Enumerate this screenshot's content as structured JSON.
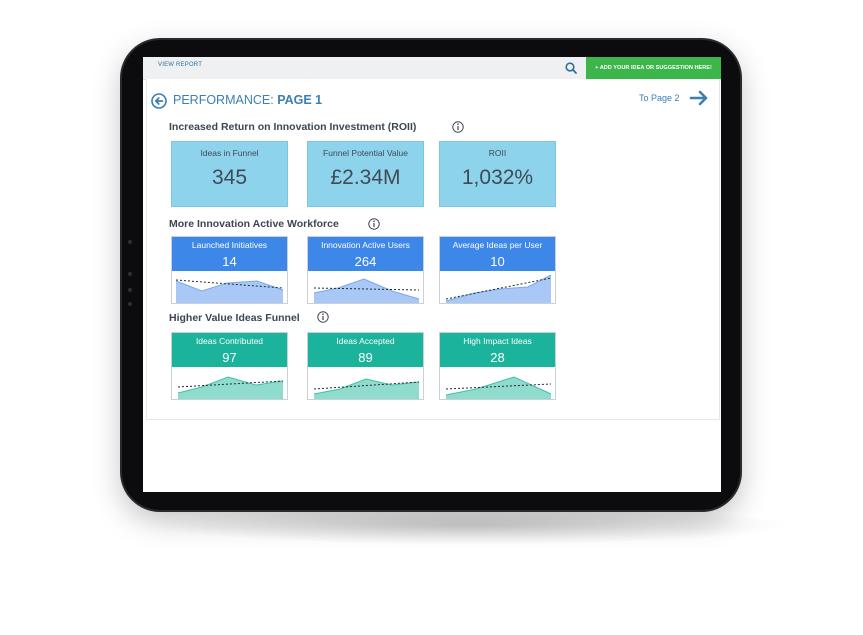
{
  "header": {
    "view_report": "VIEW REPORT",
    "add_button": "+ ADD YOUR IDEA OR SUGGESTION HERE!"
  },
  "page": {
    "title_prefix": "PERFORMANCE: ",
    "title_page": "PAGE 1",
    "next_link": "To Page 2"
  },
  "sections": [
    {
      "title": "Increased Return on Innovation Investment (ROII)",
      "cards": [
        {
          "label": "Ideas in Funnel",
          "value": "345"
        },
        {
          "label": "Funnel Potential Value",
          "value": "£2.34M"
        },
        {
          "label": "ROII",
          "value": "1,032%"
        }
      ]
    },
    {
      "title": "More Innovation Active Workforce",
      "cards": [
        {
          "label": "Launched Initiatives",
          "value": "14"
        },
        {
          "label": "Innovation Active Users",
          "value": "264"
        },
        {
          "label": "Average Ideas per User",
          "value": "10"
        }
      ]
    },
    {
      "title": "Higher Value Ideas Funnel",
      "cards": [
        {
          "label": "Ideas Contributed",
          "value": "97"
        },
        {
          "label": "Ideas Accepted",
          "value": "89"
        },
        {
          "label": "High Impact Ideas",
          "value": "28"
        }
      ]
    }
  ],
  "colors": {
    "accent_blue": "#3d87e8",
    "accent_teal": "#1bb39c",
    "kpi_fill": "#8dd3ec",
    "add_button": "#3cb54a",
    "title_blue": "#3b7fb2"
  },
  "icons": [
    "search-icon",
    "back-arrow-icon",
    "forward-arrow-icon",
    "info-icon"
  ]
}
